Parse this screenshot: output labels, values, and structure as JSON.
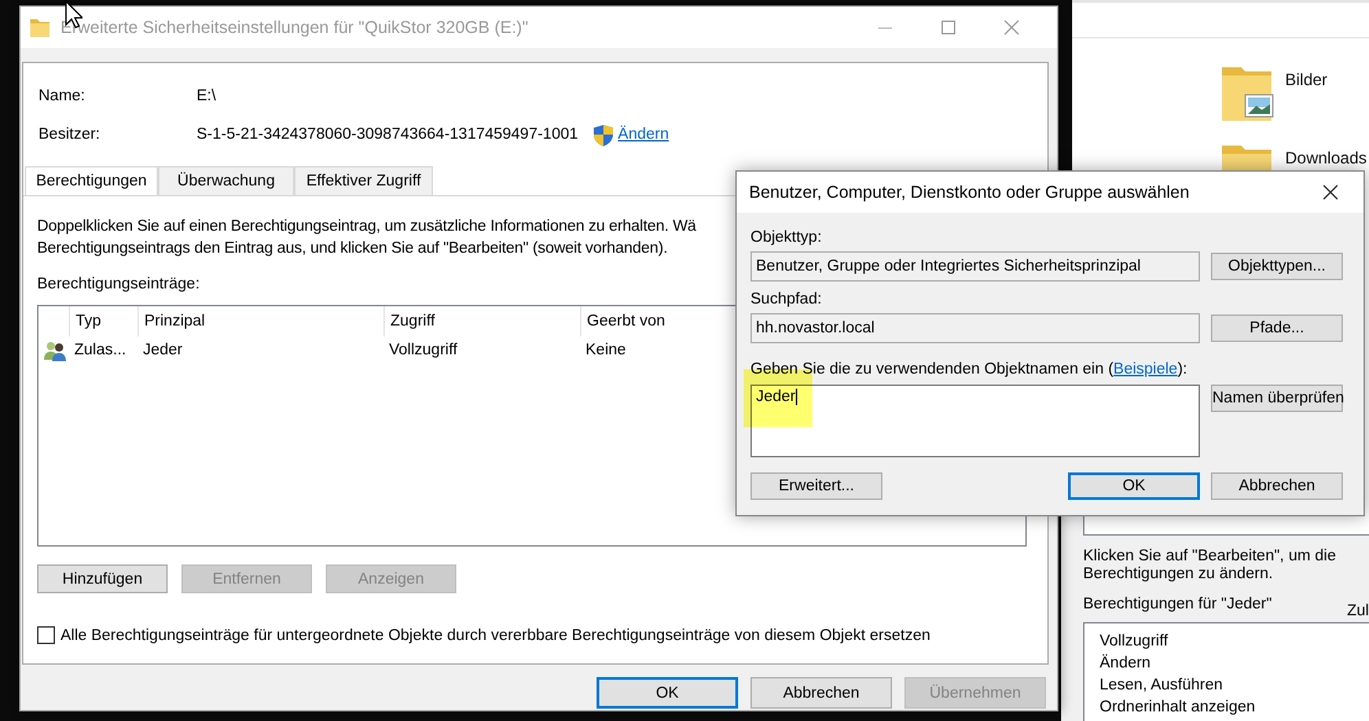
{
  "main_window": {
    "title": "Erweiterte Sicherheitseinstellungen für \"QuikStor 320GB (E:)\"",
    "details": [
      {
        "label": "Name:",
        "value": "E:\\"
      },
      {
        "label": "Besitzer:",
        "value": "S-1-5-21-3424378060-3098743664-1317459497-1001",
        "link": "Ändern"
      }
    ],
    "tabs": [
      {
        "label": "Berechtigungen",
        "selected": true
      },
      {
        "label": "Überwachung",
        "selected": false
      },
      {
        "label": "Effektiver Zugriff",
        "selected": false
      }
    ],
    "description": [
      "Doppelklicken Sie auf einen Berechtigungseintrag, um zusätzliche Informationen zu erhalten. Wä",
      "Berechtigungseintrags den Eintrag aus, und klicken Sie auf \"Bearbeiten\" (soweit vorhanden)."
    ],
    "entries_label": "Berechtigungseinträge:",
    "table": {
      "columns": [
        "Typ",
        "Prinzipal",
        "Zugriff",
        "Geerbt von"
      ],
      "rows": [
        {
          "kind": "group",
          "cells": [
            "Zulas...",
            "Jeder",
            "Vollzugriff",
            "Keine"
          ]
        }
      ]
    },
    "buttons": [
      {
        "label": "Hinzufügen",
        "disabled": false
      },
      {
        "label": "Entfernen",
        "disabled": true
      },
      {
        "label": "Anzeigen",
        "disabled": true
      }
    ],
    "replace_checkbox": {
      "label": "Alle Berechtigungseinträge für untergeordnete Objekte durch vererbbare Berechtigungseinträge von diesem Objekt ersetzen",
      "checked": false
    },
    "footer_buttons": [
      {
        "label": "OK",
        "default": true,
        "disabled": false
      },
      {
        "label": "Abbrechen",
        "default": false,
        "disabled": false
      },
      {
        "label": "Übernehmen",
        "default": false,
        "disabled": true
      }
    ]
  },
  "explorer": {
    "items": [
      {
        "name": "Bilder",
        "kind": "pictures"
      },
      {
        "name": "Downloads",
        "kind": "downloads"
      }
    ]
  },
  "permissions_window": {
    "hint": [
      "Klicken Sie auf \"Bearbeiten\", um die",
      "Berechtigungen zu ändern."
    ],
    "permissions_label": "Berechtigungen für \"Jeder\"",
    "column_label": "Zul",
    "permissions": [
      "Vollzugriff",
      "Ändern",
      "Lesen, Ausführen",
      "Ordnerinhalt anzeigen"
    ]
  },
  "select_dialog": {
    "title": "Benutzer, Computer, Dienstkonto oder Gruppe auswählen",
    "fields": [
      {
        "label": "Objekttyp:",
        "value": "Benutzer, Gruppe oder Integriertes Sicherheitsprinzipal",
        "button": "Objekttypen..."
      },
      {
        "label": "Suchpfad:",
        "value": "hh.novastor.local",
        "button": "Pfade..."
      }
    ],
    "names": {
      "label": "Geben Sie die zu verwendenden Objektnamen ein (",
      "link": "Beispiele",
      "label_end": "):",
      "value": "Jeder",
      "button": "Namen überprüfen",
      "highlighted": true
    },
    "buttons": [
      {
        "label": "Erweitert...",
        "default": false
      },
      {
        "label": "OK",
        "default": true
      },
      {
        "label": "Abbrechen",
        "default": false
      }
    ]
  }
}
